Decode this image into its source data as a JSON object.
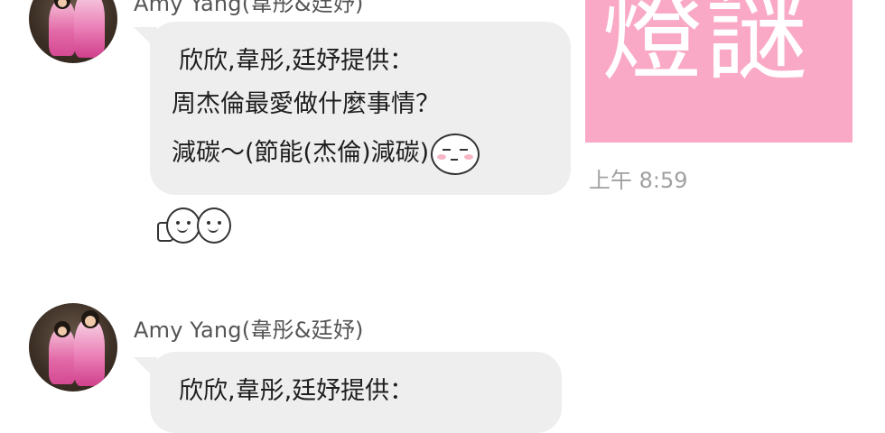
{
  "messages": [
    {
      "sender": "Amy Yang(韋彤&廷妤)",
      "lines": [
        "欣欣,韋彤,廷妤提供：",
        "周杰倫最愛做什麼事情？",
        "減碳～(節能(杰倫)減碳)"
      ],
      "emoji": "smug-face-emoji",
      "reaction_sticker": "thumbs-up-faces-sticker"
    },
    {
      "sender": "Amy Yang(韋彤&廷妤)",
      "lines": [
        "欣欣,韋彤,廷妤提供："
      ]
    }
  ],
  "image_card": {
    "text": "燈謎",
    "background": "#f9a9c6",
    "time": "上午 8:59"
  },
  "colors": {
    "bubble": "#eeeeee",
    "sender_text": "#555555",
    "time_text": "#a0a0a0",
    "accent_pink": "#f9a9c6"
  }
}
